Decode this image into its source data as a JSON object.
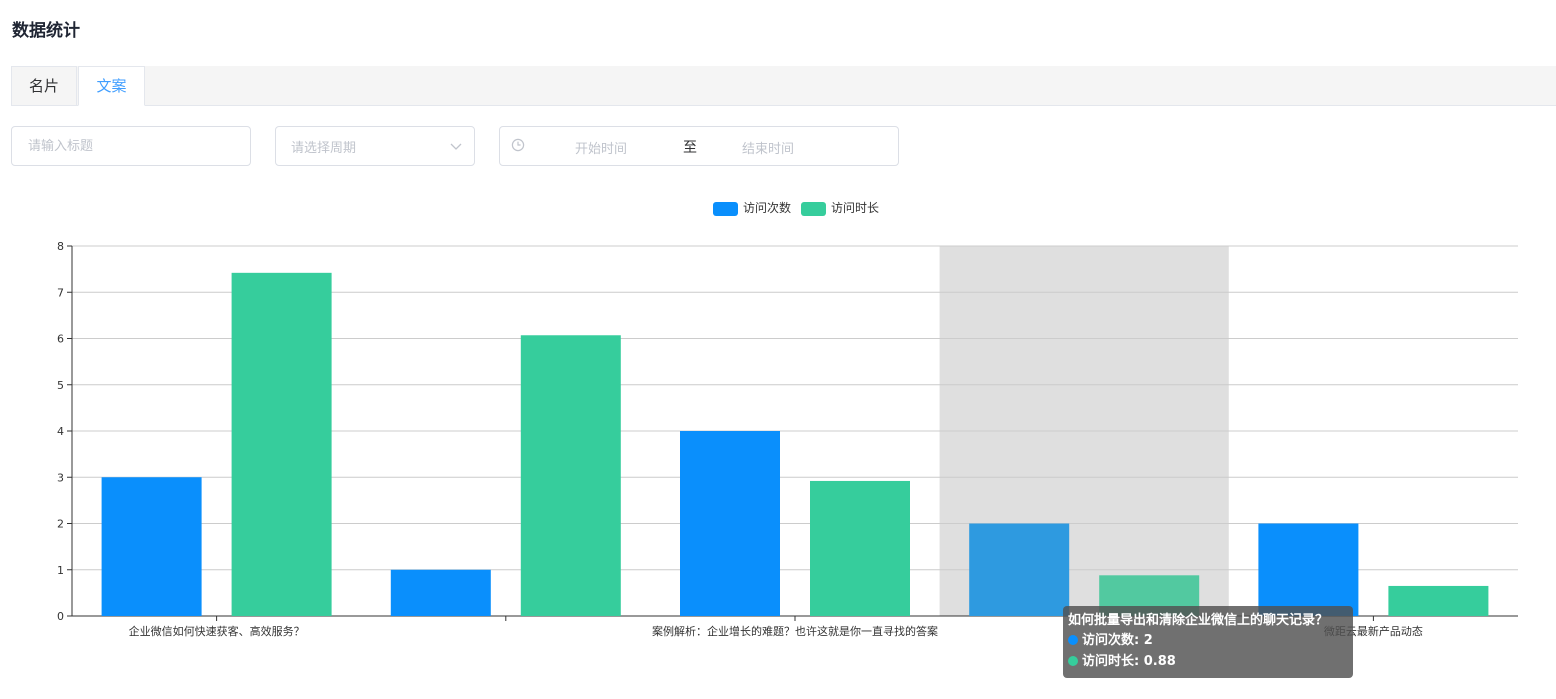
{
  "page": {
    "title": "数据统计"
  },
  "tabs": [
    {
      "label": "名片",
      "active": false
    },
    {
      "label": "文案",
      "active": true
    }
  ],
  "filters": {
    "title_placeholder": "请输入标题",
    "period_placeholder": "请选择周期",
    "start_placeholder": "开始时间",
    "range_separator": "至",
    "end_placeholder": "结束时间"
  },
  "icons": {
    "clock": "clock-icon",
    "chevron": "chevron-down-icon"
  },
  "colors": {
    "primary": "#409eff",
    "series_visits": "#0a8ffc",
    "series_duration": "#36cd9c",
    "hover_band": "#dfdfdf"
  },
  "chart_data": {
    "type": "bar",
    "categories": [
      "企业微信如何快速获客、高效服务？",
      "",
      "案例解析：企业增长的难题？也许这就是你一直寻找的答案",
      "如何批量导出和清除企业微信上的聊天记录？",
      "微距云最新产品动态"
    ],
    "x_tick_labels": [
      "企业微信如何快速获客、高效服务？",
      "",
      "案例解析：企业增长的难题？也许这就是你一直寻找的答案",
      "",
      "微距云最新产品动态"
    ],
    "series": [
      {
        "name": "访问次数",
        "color": "#0a8ffc",
        "values": [
          3,
          1,
          4,
          2,
          2
        ]
      },
      {
        "name": "访问时长",
        "color": "#36cd9c",
        "values": [
          7.42,
          6.07,
          2.92,
          0.88,
          0.65
        ]
      }
    ],
    "ylim": [
      0,
      8
    ],
    "yticks": [
      0,
      1,
      2,
      3,
      4,
      5,
      6,
      7,
      8
    ],
    "grid": true,
    "legend_position": "top-center",
    "hover_index": 3
  },
  "tooltip": {
    "title": "如何批量导出和清除企业微信上的聊天记录？",
    "rows": [
      {
        "label": "访问次数: 2",
        "color": "#0a8ffc"
      },
      {
        "label": "访问时长: 0.88",
        "color": "#36cd9c"
      }
    ]
  }
}
